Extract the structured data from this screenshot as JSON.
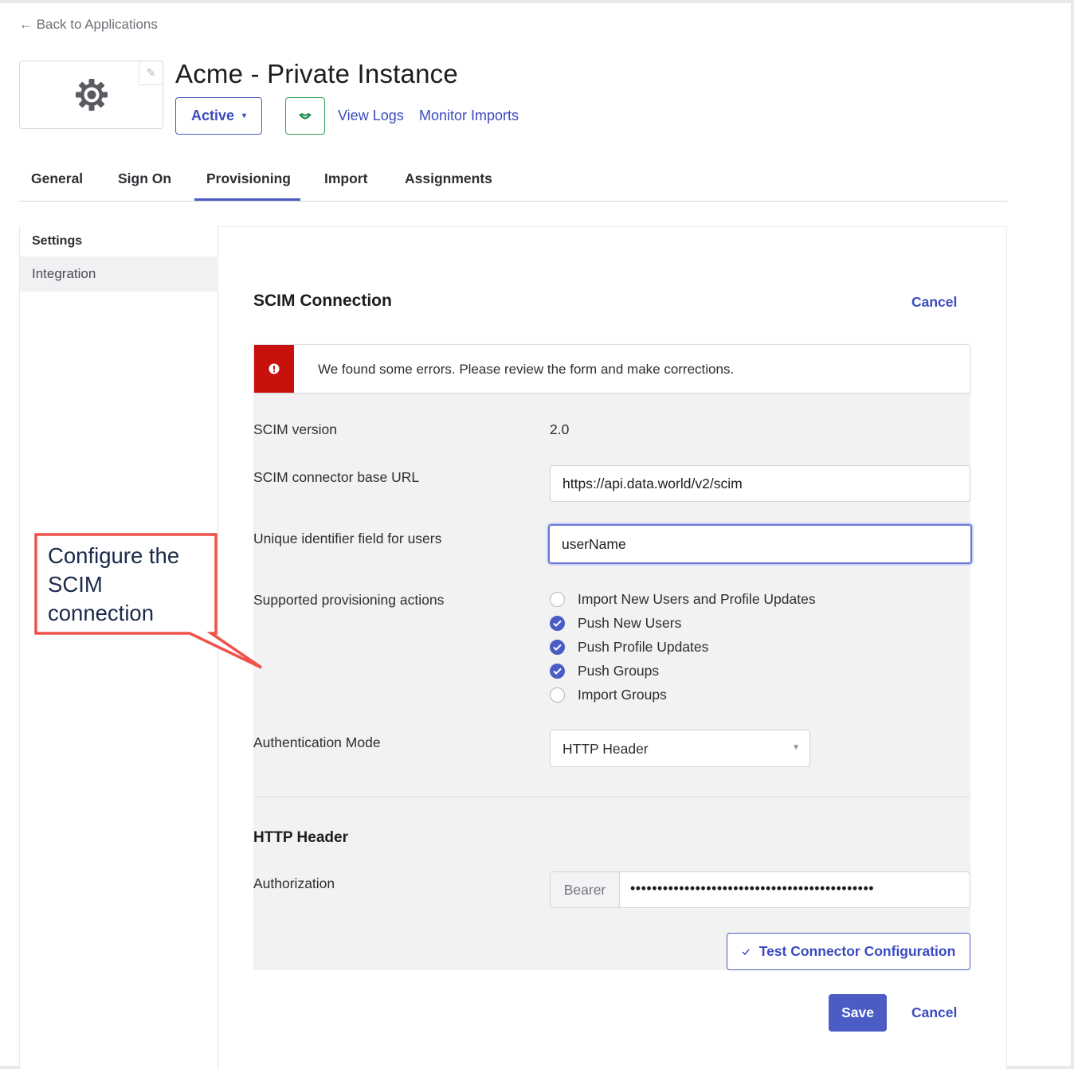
{
  "header": {
    "back_label": "← Back to Applications",
    "app_title": "Acme - Private Instance",
    "status_label": "Active",
    "status_caret": "▾",
    "links": [
      "View Logs",
      "Monitor Imports"
    ]
  },
  "tabs": [
    "General",
    "Sign On",
    "Provisioning",
    "Import",
    "Assignments"
  ],
  "active_tab": "Provisioning",
  "sidebar": {
    "heading": "Settings",
    "items": [
      {
        "label": "Integration",
        "selected": true
      }
    ]
  },
  "scim": {
    "title": "SCIM Connection",
    "cancel_label": "Cancel",
    "error_message": "We found some errors. Please review the form and make corrections.",
    "fields": {
      "version_label": "SCIM version",
      "version_value": "2.0",
      "base_url_label": "SCIM connector base URL",
      "base_url_value": "https://api.data.world/v2/scim",
      "unique_id_label": "Unique identifier field for users",
      "unique_id_value": "userName",
      "actions_label": "Supported provisioning actions",
      "actions": [
        {
          "label": "Import New Users and Profile Updates",
          "checked": false
        },
        {
          "label": "Push New Users",
          "checked": true
        },
        {
          "label": "Push Profile Updates",
          "checked": true
        },
        {
          "label": "Push Groups",
          "checked": true
        },
        {
          "label": "Import Groups",
          "checked": false
        }
      ],
      "auth_mode_label": "Authentication Mode",
      "auth_mode_value": "HTTP Header"
    },
    "http_header": {
      "title": "HTTP Header",
      "authorization_label": "Authorization",
      "prefix": "Bearer",
      "token_masked": "•••••••••••••••••••••••••••••••••••••••••••••"
    },
    "test_button_label": "Test Connector Configuration",
    "save_label": "Save",
    "cancel_bottom_label": "Cancel"
  },
  "annotation": {
    "text_lines": [
      "Configure the",
      "SCIM",
      "connection"
    ],
    "color": "#f0524a"
  },
  "colors": {
    "accent": "#4b5cc4",
    "error": "#c8110d",
    "success": "#2f9e5e"
  },
  "icons": [
    "arrow-left-icon",
    "gear-icon",
    "pencil-icon",
    "handshake-icon",
    "alert-icon",
    "checkmark-icon",
    "chevron-down-icon"
  ]
}
